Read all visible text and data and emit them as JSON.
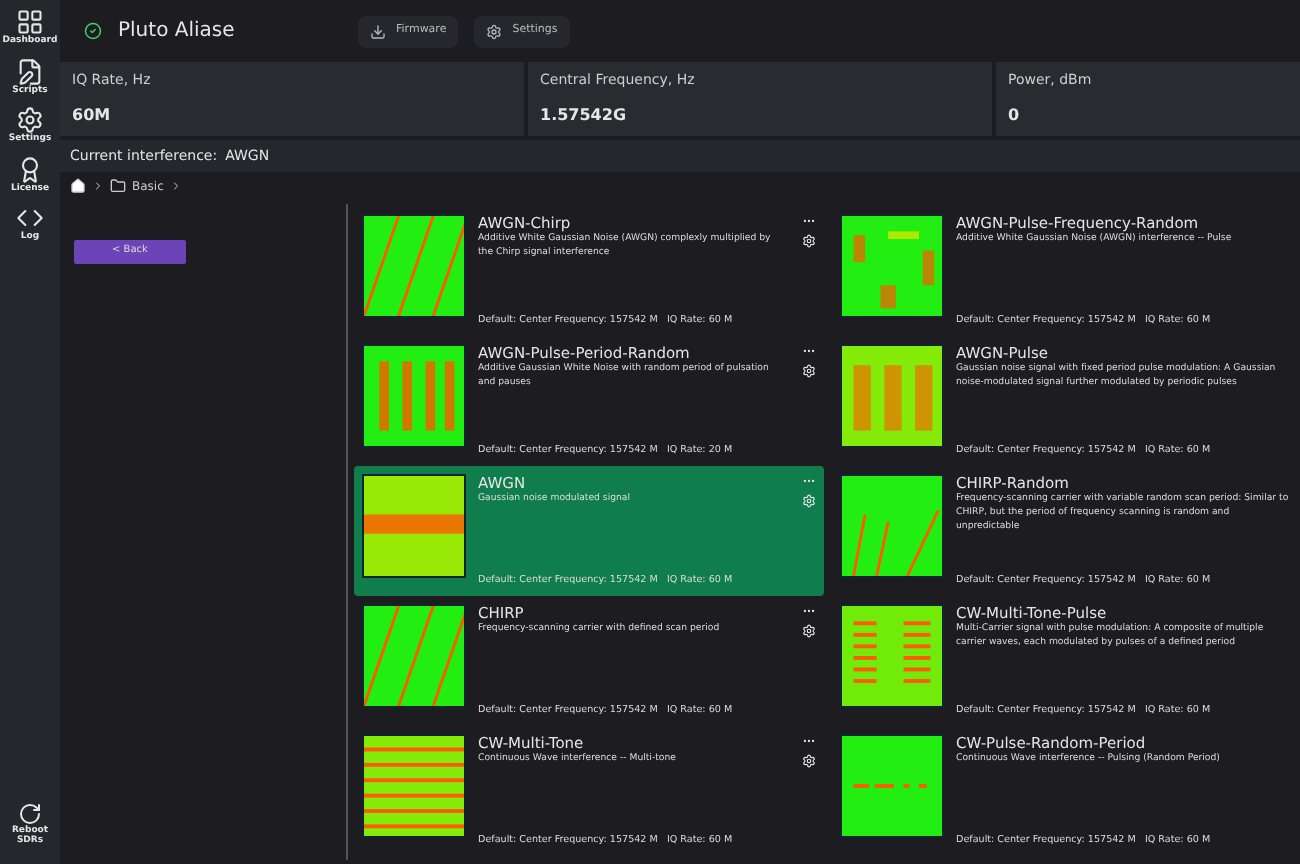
{
  "sidebar": {
    "items": [
      {
        "label": "Dashboard"
      },
      {
        "label": "Scripts"
      },
      {
        "label": "Settings"
      },
      {
        "label": "License"
      },
      {
        "label": "Log"
      }
    ],
    "bottom": {
      "label": "Reboot SDRs"
    }
  },
  "header": {
    "device": "Pluto Aliase",
    "connected": true,
    "buttons": [
      {
        "label": "Firmware"
      },
      {
        "label": "Settings"
      }
    ]
  },
  "stats": [
    {
      "label": "IQ Rate, Hz",
      "value": "60M"
    },
    {
      "label": "Central Frequency, Hz",
      "value": "1.57542G"
    },
    {
      "label": "Power, dBm",
      "value": "0"
    }
  ],
  "current_interference": {
    "label": "Current interference:",
    "value": "AWGN"
  },
  "breadcrumb": {
    "items": [
      "Basic"
    ]
  },
  "back_button": "< Back",
  "cards": [
    {
      "title": "AWGN-Chirp",
      "description": "Additive White Gaussian Noise (AWGN) complexly multiplied by the Chirp signal interference",
      "defaults": "Default: Center Frequency: 157542 M   IQ Rate: 60 M",
      "selected": false,
      "kind": "chirp",
      "actions": true
    },
    {
      "title": "AWGN-Pulse-Frequency-Random",
      "description": "Additive White Gaussian Noise (AWGN) interference -- Pulse",
      "defaults": "Default: Center Frequency: 157542 M   IQ Rate: 60 M",
      "selected": false,
      "kind": "blocks",
      "actions": false
    },
    {
      "title": "AWGN-Pulse-Period-Random",
      "description": "Additive Gaussian White Noise with random period of pulsation and pauses",
      "defaults": "Default: Center Frequency: 157542 M   IQ Rate: 20 M",
      "selected": false,
      "kind": "bars",
      "actions": true
    },
    {
      "title": "AWGN-Pulse",
      "description": "Gaussian noise signal with fixed period pulse modulation: A Gaussian noise-modulated signal further modulated by periodic pulses",
      "defaults": "Default: Center Frequency: 157542 M   IQ Rate: 60 M",
      "selected": false,
      "kind": "noisebars",
      "actions": false
    },
    {
      "title": "AWGN",
      "description": "Gaussian noise modulated signal",
      "defaults": "Default: Center Frequency: 157542 M   IQ Rate: 60 M",
      "selected": true,
      "kind": "band",
      "actions": true
    },
    {
      "title": "CHIRP-Random",
      "description": "Frequency-scanning carrier with variable random scan period: Similar to CHIRP, but the period of frequency scanning is random and unpredictable",
      "defaults": "Default: Center Frequency: 157542 M   IQ Rate: 60 M",
      "selected": false,
      "kind": "sweeps",
      "actions": false
    },
    {
      "title": "CHIRP",
      "description": "Frequency-scanning carrier with defined scan period",
      "defaults": "Default: Center Frequency: 157542 M   IQ Rate: 60 M",
      "selected": false,
      "kind": "chirp",
      "actions": true
    },
    {
      "title": "CW-Multi-Tone-Pulse",
      "description": "Multi-Carrier signal with pulse modulation: A composite of multiple carrier waves, each modulated by pulses of a defined period",
      "defaults": "Default: Center Frequency: 157542 M   IQ Rate: 60 M",
      "selected": false,
      "kind": "tonepulse",
      "actions": false
    },
    {
      "title": "CW-Multi-Tone",
      "description": "Continuous Wave interference -- Multi-tone",
      "defaults": "Default: Center Frequency: 157542 M   IQ Rate: 60 M",
      "selected": false,
      "kind": "tones",
      "actions": true
    },
    {
      "title": "CW-Pulse-Random-Period",
      "description": "Continuous Wave interference -- Pulsing (Random Period)",
      "defaults": "Default: Center Frequency: 157542 M   IQ Rate: 60 M",
      "selected": false,
      "kind": "dashes",
      "actions": false
    }
  ]
}
